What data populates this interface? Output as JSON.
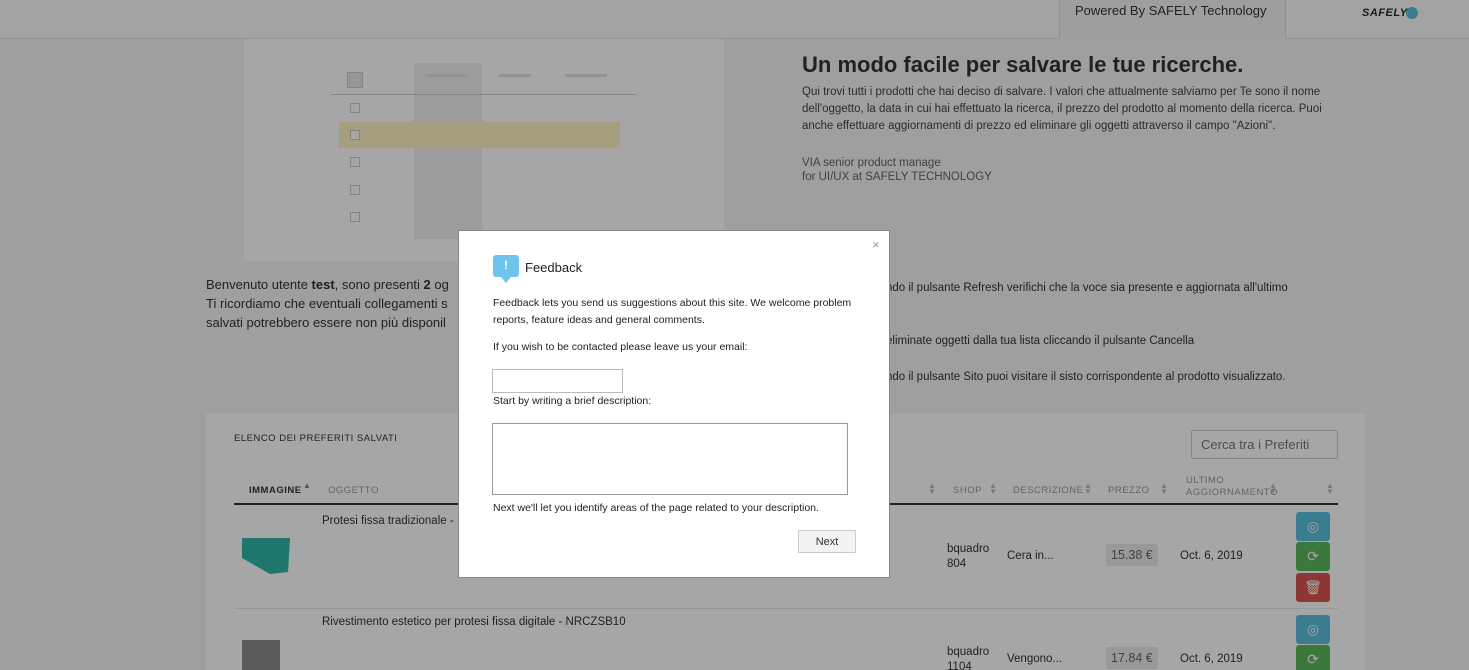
{
  "header": {
    "powered_by": "Powered By SAFELY Technology",
    "brand": "SAFELY"
  },
  "hero": {
    "title": "Un modo facile per salvare le tue ricerche.",
    "text": "Qui trovi tutti i prodotti che hai deciso di salvare. I valori che attualmente salviamo per Te sono il nome dell'oggetto, la data in cui hai effettuato la ricerca, il prezzo del prodotto al momento della ricerca. Puoi anche effettuare aggiornamenti di prezzo ed eliminare gli oggetti attraverso il campo \"Azioni\".",
    "signature_line1": "VIA senior product manage",
    "signature_line2": "for UI/UX at SAFELY TECHNOLOGY"
  },
  "welcome": {
    "prefix": "Benvenuto utente ",
    "user": "test",
    "middle": ", sono presenti ",
    "count": "2",
    "suffix": " og",
    "line2": "Ti ricordiamo che eventuali collegamenti s",
    "line3": "salvati potrebbero essere non più disponil"
  },
  "tips": {
    "refresh": "ndo il pulsante Refresh verifichi che la voce sia presente e aggiornata all'ultimo",
    "delete": "eliminate oggetti dalla tua lista cliccando il pulsante Cancella",
    "site": "ndo il pulsante Sito puoi visitare il sisto corrispondente al prodotto visualizzato."
  },
  "favorites": {
    "title": "ELENCO DEI PREFERITI SALVATI",
    "search_placeholder": "Cerca tra i Preferiti",
    "columns": {
      "image": "IMMAGINE",
      "object": "OGGETTO",
      "shop": "SHOP",
      "description": "DESCRIZIONE",
      "price": "PREZZO",
      "updated_1": "ULTIMO",
      "updated_2": "AGGIORNAMENTO"
    },
    "rows": [
      {
        "object": "Protesi fissa tradizionale -",
        "shop_1": "bquadro",
        "shop_2": "804",
        "description": "Cera in...",
        "price": "15.38 €",
        "updated": "Oct. 6, 2019"
      },
      {
        "object": "Rivestimento estetico per protesi fissa digitale - NRCZSB10",
        "shop_1": "bquadro",
        "shop_2": "1104",
        "description": "Vengono...",
        "price": "17.84 €",
        "updated": "Oct. 6, 2019"
      }
    ],
    "icons": {
      "site": "globe-icon",
      "refresh": "refresh-icon",
      "delete": "trash-icon"
    },
    "colors": {
      "site": "#5bc0de",
      "refresh": "#5cb85c",
      "delete": "#d9534f"
    }
  },
  "modal": {
    "close": "×",
    "icon": "!",
    "title": "Feedback",
    "intro": "Feedback lets you send us suggestions about this site. We welcome problem reports, feature ideas and general comments.",
    "email_label": "If you wish to be contacted please leave us your email:",
    "email_value": "",
    "desc_label": "Start by writing a brief description:",
    "desc_value": "",
    "next_hint": "Next we'll let you identify areas of the page related to your description.",
    "next_button": "Next"
  }
}
